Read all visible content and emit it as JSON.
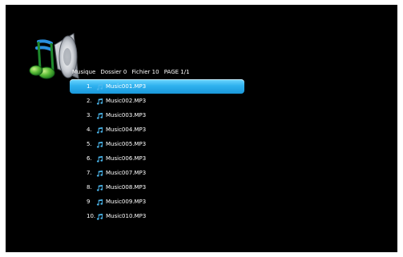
{
  "header": {
    "label": "Musique",
    "folders": "Dossier 0",
    "files": "Fichier 10",
    "page": "PAGE 1/1"
  },
  "icons": {
    "app": "music-speaker-icon",
    "file": "music-note-icon"
  },
  "colors": {
    "background": "#000000",
    "selection": "#2fb2ef",
    "note": "#4cb8ee",
    "text": "#ffffff"
  },
  "files": [
    {
      "index": "1.",
      "name": "Music001.MP3",
      "selected": true
    },
    {
      "index": "2.",
      "name": "Music002.MP3",
      "selected": false
    },
    {
      "index": "3.",
      "name": "Music003.MP3",
      "selected": false
    },
    {
      "index": "4.",
      "name": "Music004.MP3",
      "selected": false
    },
    {
      "index": "5.",
      "name": "Music005.MP3",
      "selected": false
    },
    {
      "index": "6.",
      "name": "Music006.MP3",
      "selected": false
    },
    {
      "index": "7.",
      "name": "Music007.MP3",
      "selected": false
    },
    {
      "index": "8.",
      "name": "Music008.MP3",
      "selected": false
    },
    {
      "index": "9",
      "name": "Music009.MP3",
      "selected": false
    },
    {
      "index": "10.",
      "name": "Music010.MP3",
      "selected": false
    }
  ]
}
